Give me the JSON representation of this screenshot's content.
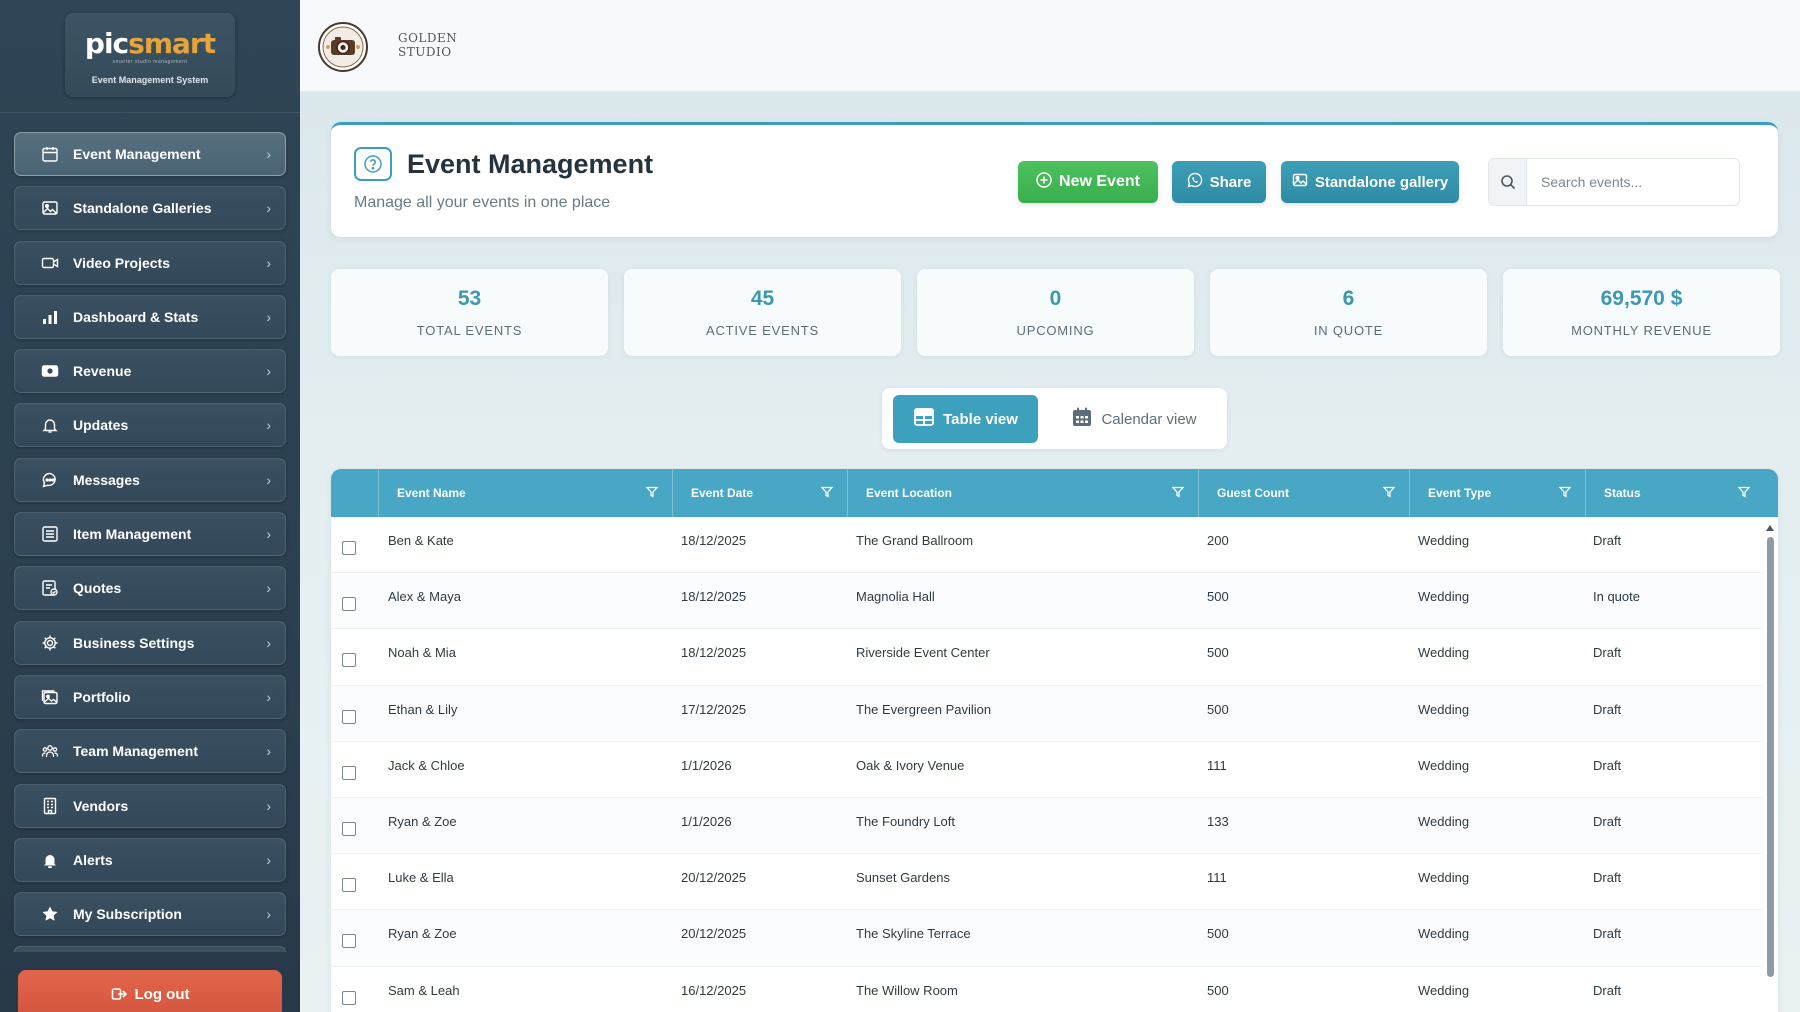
{
  "sidebar": {
    "logo_pic": "pic",
    "logo_smart": "smart",
    "logo_tagline": "smarter studio management",
    "logo_subtitle": "Event Management System",
    "items": [
      {
        "label": "Event Management",
        "icon": "calendar-icon",
        "active": true
      },
      {
        "label": "Standalone Galleries",
        "icon": "gallery-icon",
        "active": false
      },
      {
        "label": "Video Projects",
        "icon": "video-icon",
        "active": false
      },
      {
        "label": "Dashboard & Stats",
        "icon": "bar-chart-icon",
        "active": false
      },
      {
        "label": "Revenue",
        "icon": "money-icon",
        "active": false
      },
      {
        "label": "Updates",
        "icon": "bell-outline-icon",
        "active": false
      },
      {
        "label": "Messages",
        "icon": "chat-icon",
        "active": false
      },
      {
        "label": "Item Management",
        "icon": "list-icon",
        "active": false
      },
      {
        "label": "Quotes",
        "icon": "quote-icon",
        "active": false
      },
      {
        "label": "Business Settings",
        "icon": "gear-icon",
        "active": false
      },
      {
        "label": "Portfolio",
        "icon": "portfolio-icon",
        "active": false
      },
      {
        "label": "Team Management",
        "icon": "team-icon",
        "active": false
      },
      {
        "label": "Vendors",
        "icon": "building-icon",
        "active": false
      },
      {
        "label": "Alerts",
        "icon": "bell-solid-icon",
        "active": false
      },
      {
        "label": "My Subscription",
        "icon": "star-icon",
        "active": false
      }
    ],
    "logout_label": "Log out"
  },
  "topbar": {
    "studio_line1": "GOLDEN",
    "studio_line2": "STUDIO"
  },
  "header": {
    "title": "Event Management",
    "subtitle": "Manage all your events in one place",
    "new_event_label": "New Event",
    "share_label": "Share",
    "gallery_label": "Standalone gallery",
    "search_placeholder": "Search events..."
  },
  "stats": [
    {
      "value": "53",
      "label": "TOTAL EVENTS"
    },
    {
      "value": "45",
      "label": "ACTIVE EVENTS"
    },
    {
      "value": "0",
      "label": "UPCOMING"
    },
    {
      "value": "6",
      "label": "IN QUOTE"
    },
    {
      "value": "69,570 $",
      "label": "MONTHLY REVENUE"
    }
  ],
  "view_toggle": {
    "table_label": "Table view",
    "calendar_label": "Calendar view"
  },
  "table": {
    "columns": [
      "Event Name",
      "Event Date",
      "Event Location",
      "Guest Count",
      "Event Type",
      "Status"
    ],
    "rows": [
      [
        "Ben & Kate",
        "18/12/2025",
        "The Grand Ballroom",
        "200",
        "Wedding",
        "Draft"
      ],
      [
        "Alex & Maya",
        "18/12/2025",
        "Magnolia Hall",
        "500",
        "Wedding",
        "In quote"
      ],
      [
        "Noah & Mia",
        "18/12/2025",
        "Riverside Event Center",
        "500",
        "Wedding",
        "Draft"
      ],
      [
        "Ethan & Lily",
        "17/12/2025",
        "The Evergreen Pavilion",
        "500",
        "Wedding",
        "Draft"
      ],
      [
        "Jack & Chloe",
        "1/1/2026",
        "Oak & Ivory Venue",
        "111",
        "Wedding",
        "Draft"
      ],
      [
        "Ryan & Zoe",
        "1/1/2026",
        "The Foundry Loft",
        "133",
        "Wedding",
        "Draft"
      ],
      [
        "Luke & Ella",
        "20/12/2025",
        "Sunset Gardens",
        "111",
        "Wedding",
        "Draft"
      ],
      [
        "Ryan & Zoe",
        "20/12/2025",
        "The Skyline Terrace",
        "500",
        "Wedding",
        "Draft"
      ],
      [
        "Sam & Leah",
        "16/12/2025",
        "The Willow Room",
        "500",
        "Wedding",
        "Draft"
      ]
    ]
  },
  "colors": {
    "accent": "#3da0bc",
    "sidebar_bg": "#2f4656",
    "new_event": "#42b855",
    "logout": "#d95a42",
    "logo_orange": "#e7a43c"
  }
}
